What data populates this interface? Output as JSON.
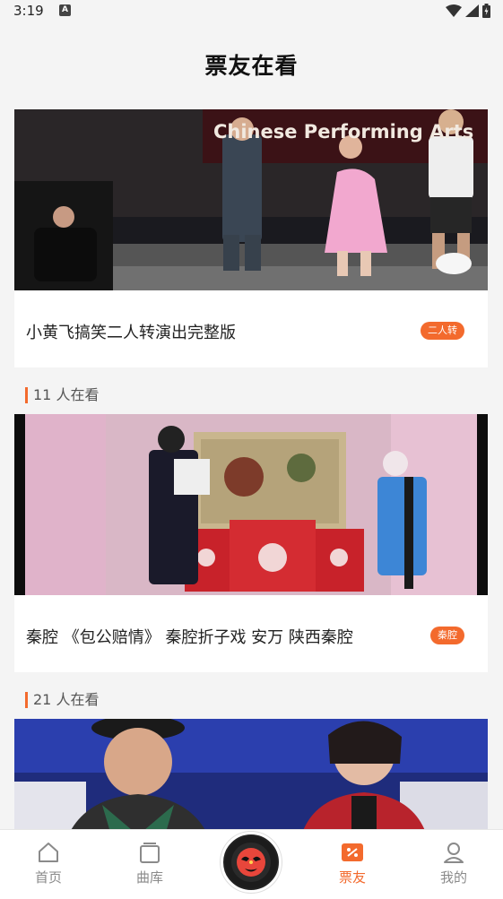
{
  "status": {
    "time": "3:19",
    "notif_glyph": "A"
  },
  "header": {
    "title": "票友在看"
  },
  "feed": [
    {
      "title": "小黄飞搞笑二人转演出完整版",
      "tag": "二人转",
      "viewers": "",
      "banner_text": "Chinese Performing Arts"
    },
    {
      "title": "秦腔 《包公赔情》 秦腔折子戏 安万 陕西秦腔",
      "tag": "秦腔",
      "viewers": "11 人在看"
    },
    {
      "title": "",
      "tag": "",
      "viewers": "21 人在看"
    }
  ],
  "tabbar": {
    "items": [
      {
        "label": "首页",
        "icon": "home-icon"
      },
      {
        "label": "曲库",
        "icon": "library-icon"
      },
      {
        "label": "",
        "icon": "opera-mask-record-icon"
      },
      {
        "label": "票友",
        "icon": "ticket-icon",
        "active": true
      },
      {
        "label": "我的",
        "icon": "profile-icon"
      }
    ]
  },
  "colors": {
    "accent": "#f36a2d",
    "background": "#f4f4f4",
    "tab_inactive": "#8a8a8a"
  }
}
